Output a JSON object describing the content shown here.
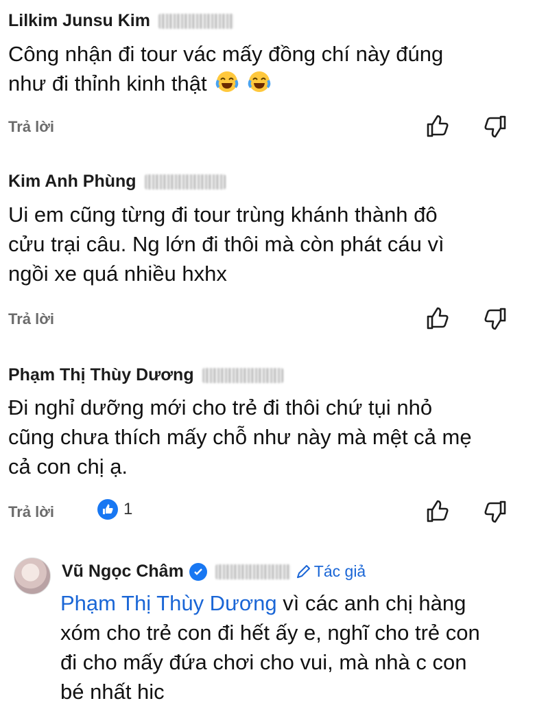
{
  "comments": [
    {
      "author": "Lilkim Junsu Kim",
      "text_lines": [
        "Công nhận đi tour vác mấy đồng chí này đúng",
        "như đi thỉnh kinh thật"
      ],
      "emojis": [
        "face-with-tears-of-joy",
        "face-with-tears-of-joy"
      ],
      "reply_label": "Trả lời"
    },
    {
      "author": "Kim Anh Phùng",
      "text_lines": [
        "Ui em cũng từng đi tour trùng khánh thành đô",
        "cửu trại câu. Ng lớn đi thôi mà còn phát cáu vì",
        "ngồi xe quá nhiều hxhx"
      ],
      "reply_label": "Trả lời"
    },
    {
      "author": "Phạm Thị Thùy Dương",
      "text_lines": [
        "Đi nghỉ dưỡng mới cho trẻ đi thôi chứ tụi nhỏ",
        "cũng chưa thích mấy chỗ như này mà mệt cả mẹ",
        "cả con chị ạ."
      ],
      "reply_label": "Trả lời",
      "reaction": {
        "icon": "like-icon",
        "count": "1"
      }
    }
  ],
  "reply": {
    "author": "Vũ Ngọc Châm",
    "badge_label": "Tác giả",
    "mention": "Phạm Thị Thùy Dương",
    "text_first": " vì các anh chị hàng",
    "text_lines": [
      "xóm cho trẻ con đi hết ấy e, nghĩ cho trẻ con",
      "đi cho mấy đứa chơi cho vui, mà nhà c con",
      "bé nhất hic"
    ]
  },
  "colors": {
    "link": "#1a66d6",
    "verified": "#1877f2",
    "muted": "#6b6b6b"
  }
}
